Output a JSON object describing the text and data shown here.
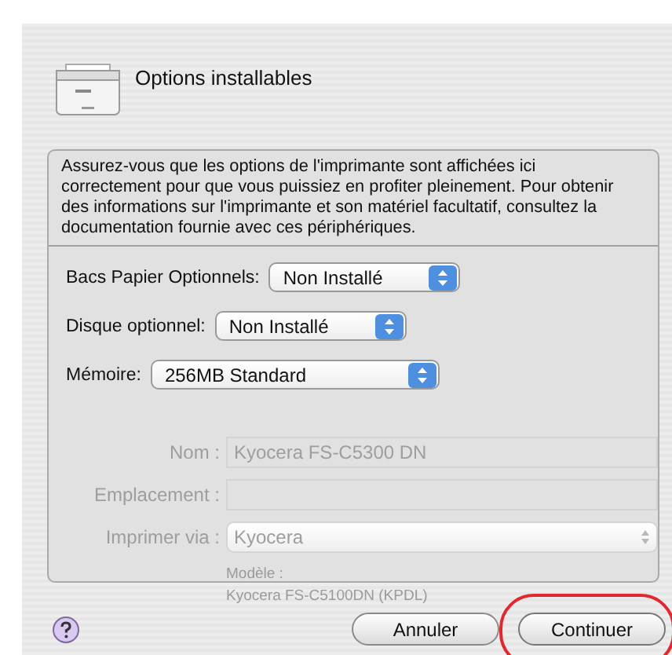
{
  "sheet": {
    "title": "Options installables",
    "intro": "Assurez-vous que les options de l'imprimante sont affichées ici correctement pour que vous puissiez en profiter pleinement. Pour obtenir des informations sur l'imprimante et son matériel facultatif, consultez la documentation fournie avec ces périphériques.",
    "options": [
      {
        "label": "Bacs Papier Optionnels:",
        "value": "Non Installé"
      },
      {
        "label": "Disque optionnel:",
        "value": "Non Installé"
      },
      {
        "label": "Mémoire:",
        "value": "256MB Standard"
      }
    ],
    "buttons": [
      {
        "label": "Annuler",
        "kind": "cancel",
        "highlighted": false
      },
      {
        "label": "Continuer",
        "kind": "default",
        "highlighted": true
      }
    ]
  },
  "background": {
    "fields": [
      {
        "label": "Nom :",
        "value": "Kyocera FS-C5300 DN",
        "kind": "text"
      },
      {
        "label": "Emplacement :",
        "kind": "text"
      },
      {
        "label": "Imprimer via :",
        "value": "Kyocera",
        "kind": "popup"
      }
    ],
    "model_list": [
      "Modèle :",
      "Kyocera FS-C5100DN (KPDL)"
    ]
  }
}
